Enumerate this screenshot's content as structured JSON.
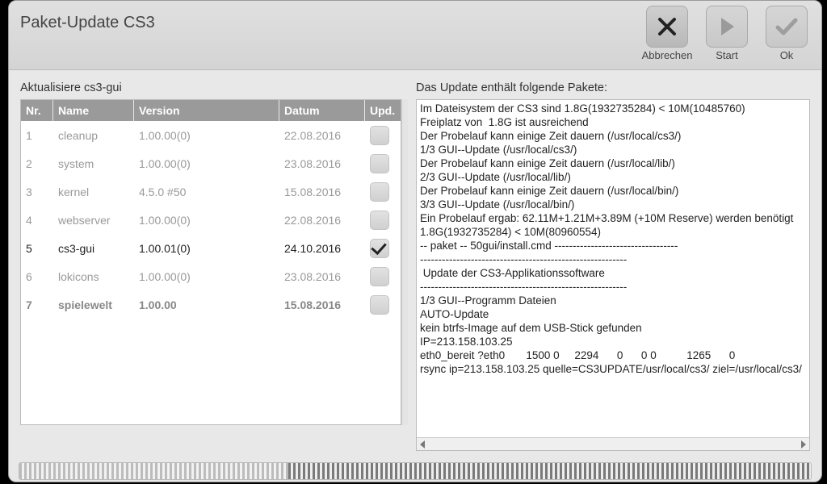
{
  "window": {
    "title": "Paket-Update CS3"
  },
  "toolbar": {
    "cancel_label": "Abbrechen",
    "start_label": "Start",
    "ok_label": "Ok"
  },
  "left": {
    "label": "Aktualisiere cs3-gui",
    "columns": {
      "nr": "Nr.",
      "name": "Name",
      "version": "Version",
      "date": "Datum",
      "upd": "Upd."
    },
    "rows": [
      {
        "nr": "1",
        "name": "cleanup",
        "version": "1.00.00(0)",
        "date": "22.08.2016",
        "checked": false,
        "style": "dim"
      },
      {
        "nr": "2",
        "name": "system",
        "version": "1.00.00(0)",
        "date": "23.08.2016",
        "checked": false,
        "style": "dim"
      },
      {
        "nr": "3",
        "name": "kernel",
        "version": "4.5.0 #50",
        "date": "15.08.2016",
        "checked": false,
        "style": "dim"
      },
      {
        "nr": "4",
        "name": "webserver",
        "version": "1.00.00(0)",
        "date": "22.08.2016",
        "checked": false,
        "style": "dim"
      },
      {
        "nr": "5",
        "name": "cs3-gui",
        "version": "1.00.01(0)",
        "date": "24.10.2016",
        "checked": true,
        "style": "highlight"
      },
      {
        "nr": "6",
        "name": "lokicons",
        "version": "1.00.00(0)",
        "date": "23.08.2016",
        "checked": false,
        "style": "dim"
      },
      {
        "nr": "7",
        "name": "spielewelt",
        "version": "1.00.00",
        "date": "15.08.2016",
        "checked": false,
        "style": "bold"
      }
    ]
  },
  "right": {
    "label": "Das Update enthält folgende Pakete:",
    "log": "Im Dateisystem der CS3 sind 1.8G(1932735284) < 10M(10485760)\nFreiplatz von  1.8G ist ausreichend\nDer Probelauf kann einige Zeit dauern (/usr/local/cs3/)\n1/3 GUI--Update (/usr/local/cs3/)\nDer Probelauf kann einige Zeit dauern (/usr/local/lib/)\n2/3 GUI--Update (/usr/local/lib/)\nDer Probelauf kann einige Zeit dauern (/usr/local/bin/)\n3/3 GUI--Update (/usr/local/bin/)\nEin Probelauf ergab: 62.11M+1.21M+3.89M (+10M Reserve) werden benötigt\n1.8G(1932735284) < 10M(80960554)\n-- paket -- 50gui/install.cmd ----------------------------------\n---------------------------------------------------------\n Update der CS3-Applikationssoftware\n---------------------------------------------------------\n1/3 GUI--Programm Dateien\nAUTO-Update\nkein btrfs-Image auf dem USB-Stick gefunden\nIP=213.158.103.25\neth0_bereit ?eth0       1500 0     2294      0      0 0          1265      0\nrsync ip=213.158.103.25 quelle=CS3UPDATE/usr/local/cs3/ ziel=/usr/local/cs3/"
  },
  "progress": {
    "percent": 34
  }
}
